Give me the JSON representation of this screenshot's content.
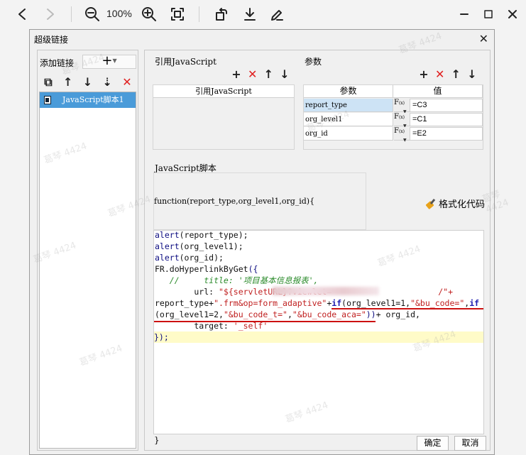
{
  "viewer": {
    "zoom": "100%"
  },
  "dialog": {
    "title": "超级链接",
    "close_glyph": "✕"
  },
  "left_panel": {
    "add_link_label": "添加链接",
    "add_button_glyph": "+",
    "links": [
      "JavaScript脚本1"
    ]
  },
  "ref_js": {
    "title": "引用JavaScript",
    "column": "引用JavaScript"
  },
  "params": {
    "title": "参数",
    "col_name": "参数",
    "col_value": "值",
    "fx_label": "F",
    "fx_sub": "(x)",
    "rows": [
      {
        "name": "report_type",
        "value": "=C3"
      },
      {
        "name": "org_level1",
        "value": "=C1"
      },
      {
        "name": "org_id",
        "value": "=E2"
      }
    ]
  },
  "script": {
    "title": "JavaScript脚本",
    "signature": "function(report_type,org_level1,org_id){",
    "format_label": "格式化代码",
    "lines": {
      "l1a": "alert",
      "l1b": "(report_type);",
      "l2a": "alert",
      "l2b": "(org_level1);",
      "l3a": "alert",
      "l3b": "(org_id);",
      "l4a": "FR.doHyperlinkByGet",
      "l4b": "({",
      "l5": "   //     title: '项目基本信息报表',",
      "l6a": "        url: ",
      "l6b": "\"${servletURL}?viewlet=",
      "l6c": "/\"+",
      "l7a": "report_type+",
      "l7b": "\".frm&op=form_adaptive\"",
      "l7c": "+",
      "l7d": "if",
      "l7e": "(org_level1=1,",
      "l7f": "\"&bu_code=\"",
      "l7g": ",",
      "l7h": "if",
      "l8a": "(org_level1=2,",
      "l8b": "\"&bu_code_t=\"",
      "l8c": ",",
      "l8d": "\"&bu_code_aca=\"",
      "l8e": "))",
      "l8f": "+ org_id,",
      "l9a": "        target: ",
      "l9b": "'_self'",
      "l10": "});"
    },
    "closing": "}"
  },
  "buttons": {
    "ok": "确定",
    "cancel": "取消"
  },
  "watermark": "葛琴 4424"
}
